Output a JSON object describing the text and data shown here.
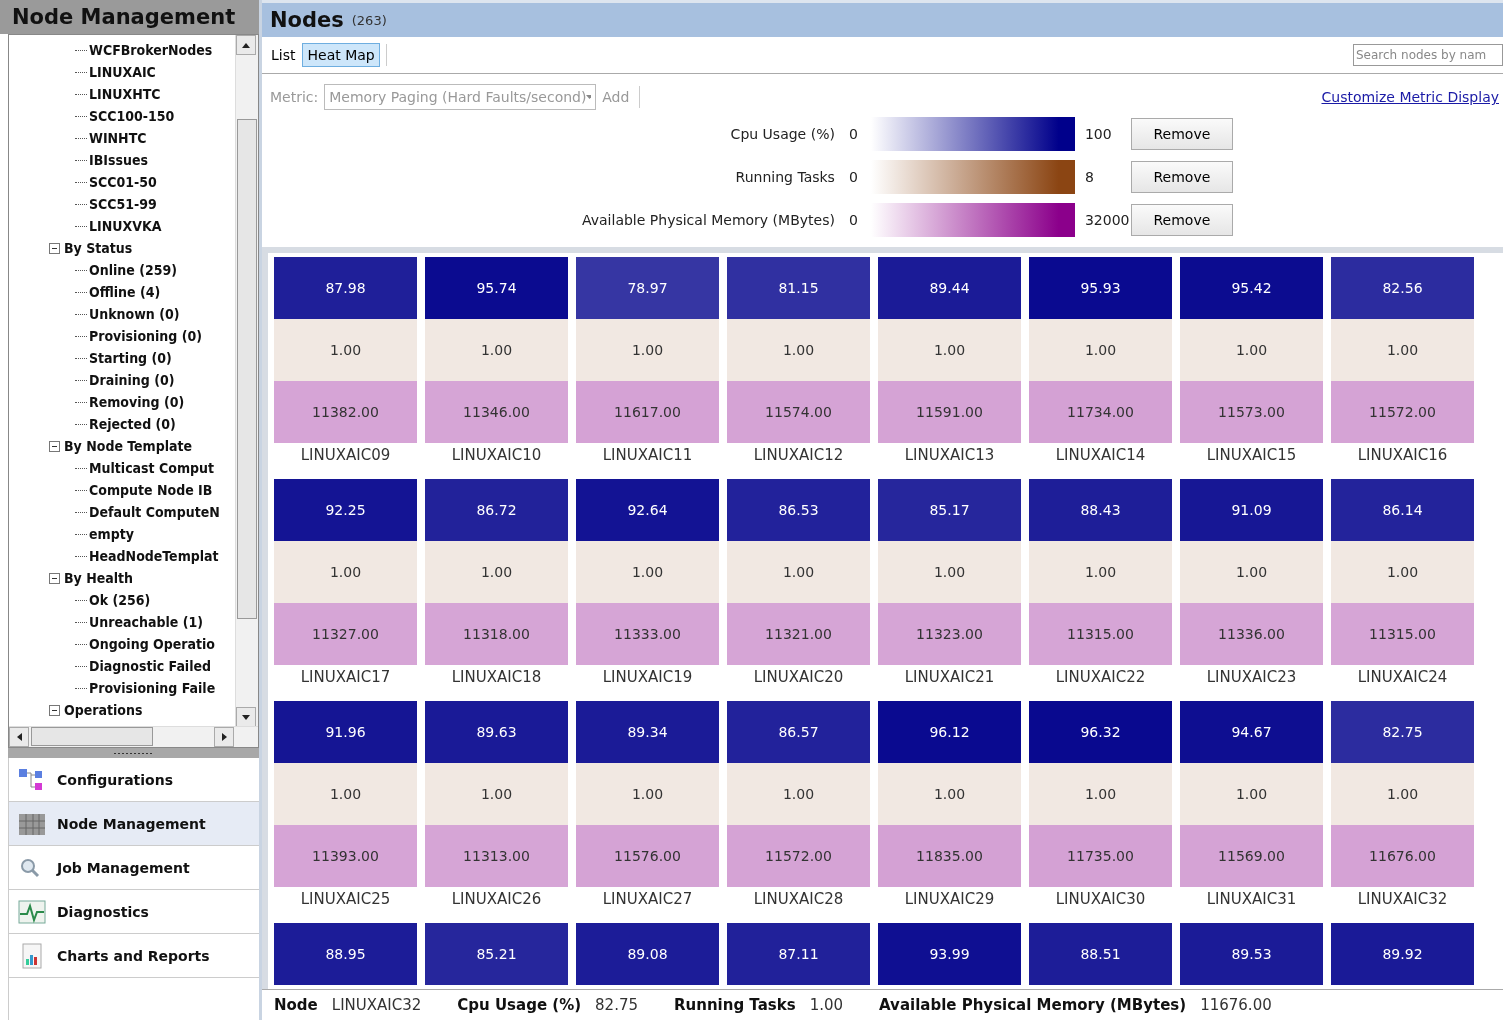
{
  "sidebar": {
    "title": "Node Management",
    "tree": [
      {
        "children": [
          {
            "children": [
              {
                "label": "WCFBrokerNodes"
              },
              {
                "label": "LINUXAIC"
              },
              {
                "label": "LINUXHTC"
              },
              {
                "label": "SCC100-150"
              },
              {
                "label": "WINHTC"
              },
              {
                "label": "IBIssues"
              },
              {
                "label": "SCC01-50"
              },
              {
                "label": "SCC51-99"
              },
              {
                "label": "LINUXVKA"
              }
            ]
          },
          {
            "label": "By Status",
            "expanded": true,
            "children": [
              {
                "label": "Online (259)"
              },
              {
                "label": "Offline (4)"
              },
              {
                "label": "Unknown (0)"
              },
              {
                "label": "Provisioning (0)"
              },
              {
                "label": "Starting (0)"
              },
              {
                "label": "Draining (0)"
              },
              {
                "label": "Removing (0)"
              },
              {
                "label": "Rejected (0)"
              }
            ]
          },
          {
            "label": "By Node Template",
            "expanded": true,
            "children": [
              {
                "label": "Multicast Comput"
              },
              {
                "label": "Compute Node IB"
              },
              {
                "label": "Default ComputeN"
              },
              {
                "label": "empty"
              },
              {
                "label": "HeadNodeTemplat"
              }
            ]
          },
          {
            "label": "By Health",
            "expanded": true,
            "children": [
              {
                "label": "Ok (256)"
              },
              {
                "label": "Unreachable (1)"
              },
              {
                "label": "Ongoing Operatio"
              },
              {
                "label": "Diagnostic Failed"
              },
              {
                "label": "Provisioning Faile"
              }
            ]
          }
        ]
      },
      {
        "label": "Operations",
        "expanded": true
      }
    ],
    "nav": [
      {
        "label": "Configurations",
        "kind": "config",
        "selected": false
      },
      {
        "label": "Node Management",
        "kind": "nodes",
        "selected": true
      },
      {
        "label": "Job Management",
        "kind": "jobs",
        "selected": false
      },
      {
        "label": "Diagnostics",
        "kind": "diag",
        "selected": false
      },
      {
        "label": "Charts and Reports",
        "kind": "charts",
        "selected": false
      }
    ]
  },
  "main": {
    "title": "Nodes",
    "count": "(263)",
    "tabs": [
      {
        "label": "List",
        "selected": false
      },
      {
        "label": "Heat Map",
        "selected": true
      }
    ],
    "search": {
      "placeholder": "Search nodes by nam"
    },
    "metric": {
      "label": "Metric:",
      "value": "Memory Paging (Hard Faults/second)",
      "add": "Add",
      "disabled": true
    },
    "customize_link": "Customize Metric Display",
    "legend": [
      {
        "name": "Cpu Usage (%)",
        "min": "0",
        "max": "100",
        "color": "#00008b",
        "button": "Remove"
      },
      {
        "name": "Running Tasks",
        "min": "0",
        "max": "8",
        "color": "#8b4513",
        "button": "Remove"
      },
      {
        "name": "Available Physical Memory (MBytes)",
        "min": "0",
        "max": "32000",
        "color": "#8b008b",
        "button": "Remove"
      }
    ],
    "tiles": [
      {
        "cpu": "87.98",
        "tasks": "1.00",
        "memory": "11382.00",
        "name": "LINUXAIC09"
      },
      {
        "cpu": "95.74",
        "tasks": "1.00",
        "memory": "11346.00",
        "name": "LINUXAIC10"
      },
      {
        "cpu": "78.97",
        "tasks": "1.00",
        "memory": "11617.00",
        "name": "LINUXAIC11"
      },
      {
        "cpu": "81.15",
        "tasks": "1.00",
        "memory": "11574.00",
        "name": "LINUXAIC12"
      },
      {
        "cpu": "89.44",
        "tasks": "1.00",
        "memory": "11591.00",
        "name": "LINUXAIC13"
      },
      {
        "cpu": "95.93",
        "tasks": "1.00",
        "memory": "11734.00",
        "name": "LINUXAIC14"
      },
      {
        "cpu": "95.42",
        "tasks": "1.00",
        "memory": "11573.00",
        "name": "LINUXAIC15"
      },
      {
        "cpu": "82.56",
        "tasks": "1.00",
        "memory": "11572.00",
        "name": "LINUXAIC16"
      },
      {
        "cpu": "92.25",
        "tasks": "1.00",
        "memory": "11327.00",
        "name": "LINUXAIC17"
      },
      {
        "cpu": "86.72",
        "tasks": "1.00",
        "memory": "11318.00",
        "name": "LINUXAIC18"
      },
      {
        "cpu": "92.64",
        "tasks": "1.00",
        "memory": "11333.00",
        "name": "LINUXAIC19"
      },
      {
        "cpu": "86.53",
        "tasks": "1.00",
        "memory": "11321.00",
        "name": "LINUXAIC20"
      },
      {
        "cpu": "85.17",
        "tasks": "1.00",
        "memory": "11323.00",
        "name": "LINUXAIC21"
      },
      {
        "cpu": "88.43",
        "tasks": "1.00",
        "memory": "11315.00",
        "name": "LINUXAIC22"
      },
      {
        "cpu": "91.09",
        "tasks": "1.00",
        "memory": "11336.00",
        "name": "LINUXAIC23"
      },
      {
        "cpu": "86.14",
        "tasks": "1.00",
        "memory": "11315.00",
        "name": "LINUXAIC24"
      },
      {
        "cpu": "91.96",
        "tasks": "1.00",
        "memory": "11393.00",
        "name": "LINUXAIC25"
      },
      {
        "cpu": "89.63",
        "tasks": "1.00",
        "memory": "11313.00",
        "name": "LINUXAIC26"
      },
      {
        "cpu": "89.34",
        "tasks": "1.00",
        "memory": "11576.00",
        "name": "LINUXAIC27"
      },
      {
        "cpu": "86.57",
        "tasks": "1.00",
        "memory": "11572.00",
        "name": "LINUXAIC28"
      },
      {
        "cpu": "96.12",
        "tasks": "1.00",
        "memory": "11835.00",
        "name": "LINUXAIC29"
      },
      {
        "cpu": "96.32",
        "tasks": "1.00",
        "memory": "11735.00",
        "name": "LINUXAIC30"
      },
      {
        "cpu": "94.67",
        "tasks": "1.00",
        "memory": "11569.00",
        "name": "LINUXAIC31"
      },
      {
        "cpu": "82.75",
        "tasks": "1.00",
        "memory": "11676.00",
        "name": "LINUXAIC32"
      },
      {
        "cpu": "88.95"
      },
      {
        "cpu": "85.21"
      },
      {
        "cpu": "89.08"
      },
      {
        "cpu": "87.11"
      },
      {
        "cpu": "93.99"
      },
      {
        "cpu": "88.51"
      },
      {
        "cpu": "89.53"
      },
      {
        "cpu": "89.92"
      }
    ],
    "status_bar": [
      {
        "label": "Node",
        "value": "LINUXAIC32"
      },
      {
        "label": "Cpu Usage (%)",
        "value": "82.75"
      },
      {
        "label": "Running Tasks",
        "value": "1.00"
      },
      {
        "label": "Available Physical Memory (MBytes)",
        "value": "11676.00"
      }
    ]
  }
}
